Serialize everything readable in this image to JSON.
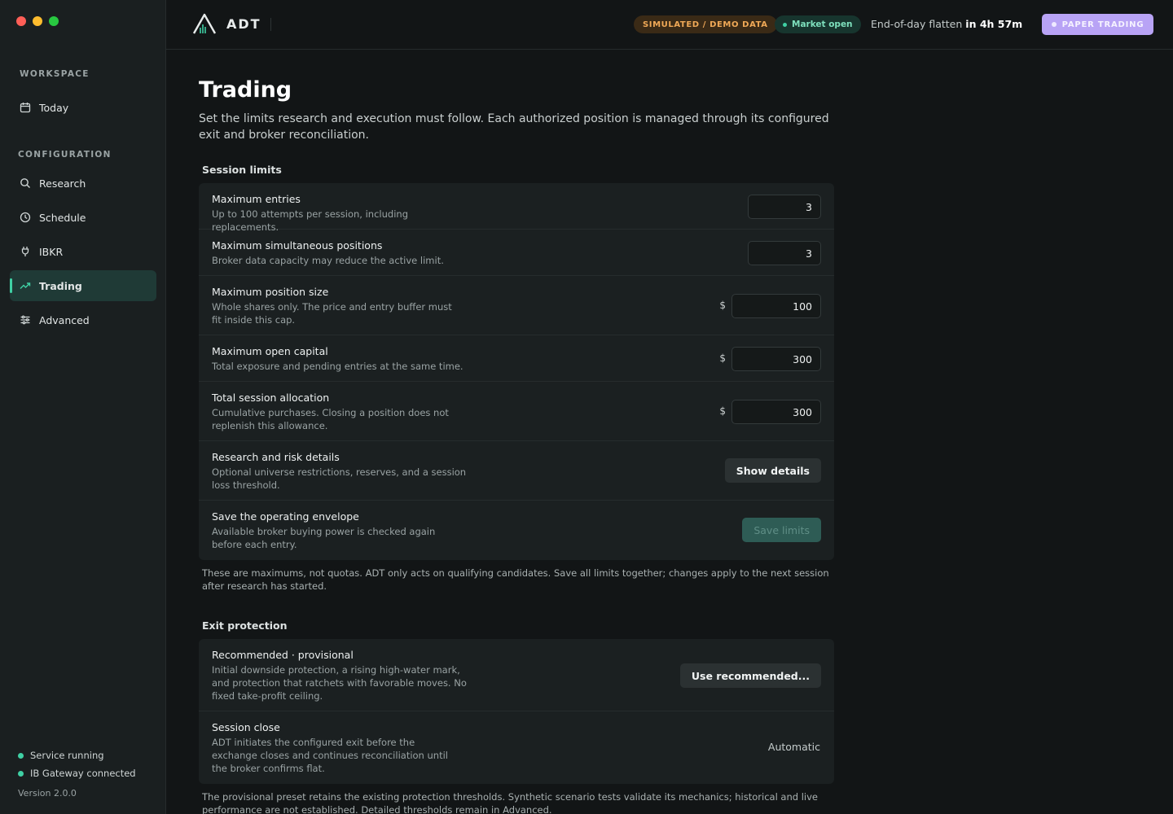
{
  "colors": {
    "accent": "#3fd0a4",
    "demo_pill": "#f0a957",
    "paper_pill": "#b8a3f5",
    "traffic_red": "#ff5f57",
    "traffic_yellow": "#febc2e",
    "traffic_green": "#28c840"
  },
  "sidebar": {
    "workspace_label": "WORKSPACE",
    "configuration_label": "CONFIGURATION",
    "items": [
      {
        "label": "Today",
        "icon": "calendar-icon"
      },
      {
        "label": "Research",
        "icon": "search-icon"
      },
      {
        "label": "Schedule",
        "icon": "clock-icon"
      },
      {
        "label": "IBKR",
        "icon": "plug-icon"
      },
      {
        "label": "Trading",
        "icon": "trend-up-icon",
        "active": true
      },
      {
        "label": "Advanced",
        "icon": "sliders-icon"
      }
    ],
    "status": {
      "service": "Service running",
      "gateway": "IB Gateway connected",
      "version": "Version 2.0.0"
    }
  },
  "topbar": {
    "brand": "ADT",
    "demo_badge": "SIMULATED / DEMO DATA",
    "market_status": "Market open",
    "flatten_label": "End-of-day flatten",
    "flatten_time": "in 4h 57m",
    "mode_badge": "PAPER TRADING"
  },
  "page": {
    "title": "Trading",
    "description": "Set the limits research and execution must follow. Each authorized position is managed through its configured exit and broker reconciliation."
  },
  "session_limits": {
    "title": "Session limits",
    "rows": [
      {
        "label": "Maximum entries",
        "help": "Up to 100 attempts per session, including replacements.",
        "value": "3"
      },
      {
        "label": "Maximum simultaneous positions",
        "help": "Broker data capacity may reduce the active limit.",
        "value": "3"
      },
      {
        "label": "Maximum position size",
        "help": "Whole shares only. The price and entry buffer must fit inside this cap.",
        "currency": "$",
        "value": "100"
      },
      {
        "label": "Maximum open capital",
        "help": "Total exposure and pending entries at the same time.",
        "currency": "$",
        "value": "300"
      },
      {
        "label": "Total session allocation",
        "help": "Cumulative purchases. Closing a position does not replenish this allowance.",
        "currency": "$",
        "value": "300"
      },
      {
        "label": "Research and risk details",
        "help": "Optional universe restrictions, reserves, and a session loss threshold.",
        "button": "Show details"
      },
      {
        "label": "Save the operating envelope",
        "help": "Available broker buying power is checked again before each entry.",
        "button": "Save limits"
      }
    ],
    "note": "These are maximums, not quotas. ADT only acts on qualifying candidates. Save all limits together; changes apply to the next session after research has started."
  },
  "exit_protection": {
    "title": "Exit protection",
    "rows": [
      {
        "label": "Recommended · provisional",
        "help": "Initial downside protection, a rising high-water mark, and protection that ratchets with favorable moves. No fixed take-profit ceiling.",
        "button": "Use recommended..."
      },
      {
        "label": "Session close",
        "help": "ADT initiates the configured exit before the exchange closes and continues reconciliation until the broker confirms flat.",
        "value": "Automatic"
      }
    ],
    "note": "The provisional preset retains the existing protection thresholds. Synthetic scenario tests validate its mechanics; historical and live performance are not established. Detailed thresholds remain in Advanced."
  }
}
